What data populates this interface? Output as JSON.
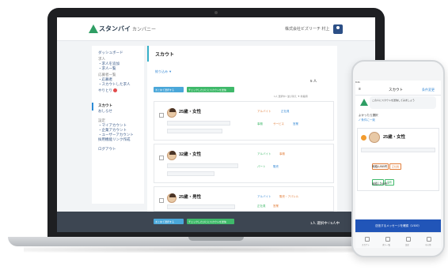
{
  "app": {
    "logo_text": "スタンバイ",
    "logo_sub": "カンパニー",
    "company": "株式会社ビズリーチ 村上"
  },
  "sidebar": {
    "items": [
      {
        "label": "ダッシュボード"
      },
      {
        "label": "求人"
      },
      {
        "label": "・求人を追加"
      },
      {
        "label": "・求人一覧"
      },
      {
        "label": "応募者一覧"
      },
      {
        "label": "・応募者"
      },
      {
        "label": "・スカウトした求人"
      },
      {
        "label": "やりとり"
      },
      {
        "label": "スカウト"
      },
      {
        "label": "おしらせ"
      },
      {
        "label": "設定"
      },
      {
        "label": "・マイアカウント"
      },
      {
        "label": "・企業アカウント"
      },
      {
        "label": "・ユーザーアカウント"
      },
      {
        "label": "採用機能リンク作成"
      },
      {
        "label": "ログアウト"
      }
    ]
  },
  "main": {
    "title": "スカウト",
    "filter": "絞り込み ▼",
    "count": "5 人",
    "toolbar": {
      "select_all": "まとめて選択する",
      "send_scout": "チェックしたひとにスカウトを送信"
    },
    "sort": "1人 選択中 / 並び替え ▼ 新着順",
    "cards": [
      {
        "age": "25歳・女性",
        "tags": [
          "アルバイト",
          "正社員"
        ],
        "tags2": [
          "事務",
          "サービス",
          "営業"
        ]
      },
      {
        "age": "32歳・女性",
        "tags": [
          "アルバイト",
          "事務"
        ],
        "tags2": [
          "パート",
          "販売"
        ]
      },
      {
        "age": "25歳・男性",
        "tags": [
          "アルバイト",
          "販売・アパレル"
        ],
        "tags2": [
          "正社員",
          "営業"
        ]
      }
    ]
  },
  "bottom_bar": {
    "select_all": "まとめて選択する",
    "send_scout": "チェックしたひとにスカウトを送信",
    "count": "1人 選択中 / 5人中"
  },
  "phone": {
    "status": "9:41",
    "menu": "≡",
    "title": "スカウト",
    "settings": "条件変更",
    "bubble": "この人にスカウトを送信してみましょう",
    "label": "よかったら選択",
    "check": "✓ 条件に一致",
    "card": {
      "age": "25歳・女性",
      "pills1": [
        "アルバイト",
        "正社員"
      ],
      "pills2": [
        "パート",
        "事務"
      ],
      "salary1": "時給1,000円",
      "salary2": "時給1,200円~"
    },
    "cta": "送信するメッセージを確認（1/100）",
    "tabs": [
      "スカウト",
      "求人一覧",
      "設定",
      "その他"
    ]
  }
}
